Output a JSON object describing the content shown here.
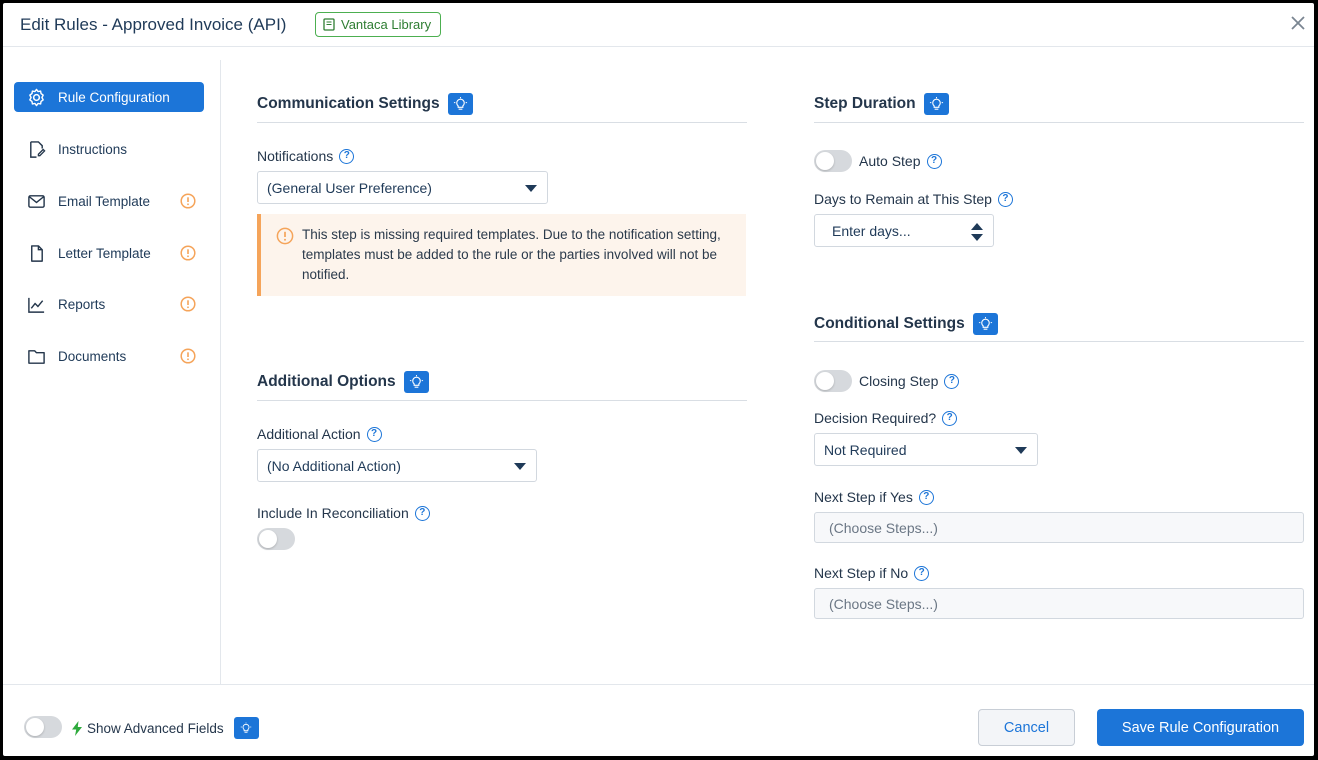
{
  "header": {
    "title": "Edit Rules - Approved Invoice (API)",
    "library_badge": "Vantaca Library",
    "close_icon": "close-icon"
  },
  "sidebar": {
    "items": [
      {
        "label": "Rule Configuration",
        "icon": "gear-icon",
        "active": true,
        "warning": false
      },
      {
        "label": "Instructions",
        "icon": "edit-document-icon",
        "active": false,
        "warning": false
      },
      {
        "label": "Email Template",
        "icon": "envelope-icon",
        "active": false,
        "warning": true
      },
      {
        "label": "Letter Template",
        "icon": "file-icon",
        "active": false,
        "warning": true
      },
      {
        "label": "Reports",
        "icon": "line-chart-icon",
        "active": false,
        "warning": true
      },
      {
        "label": "Documents",
        "icon": "folder-icon",
        "active": false,
        "warning": true
      }
    ]
  },
  "communication": {
    "heading": "Communication Settings",
    "notifications_label": "Notifications",
    "notifications_value": "(General User Preference)",
    "alert_text": "This step is missing required templates. Due to the notification setting, templates must be added to the rule or the parties involved will not be notified."
  },
  "additional": {
    "heading": "Additional Options",
    "action_label": "Additional Action",
    "action_value": "(No Additional Action)",
    "reconciliation_label": "Include In Reconciliation",
    "reconciliation_on": false
  },
  "duration": {
    "heading": "Step Duration",
    "auto_step_label": "Auto Step",
    "auto_step_on": false,
    "days_label": "Days to Remain at This Step",
    "days_placeholder": "Enter days..."
  },
  "conditional": {
    "heading": "Conditional Settings",
    "closing_step_label": "Closing Step",
    "closing_step_on": false,
    "decision_label": "Decision Required?",
    "decision_value": "Not Required",
    "next_yes_label": "Next Step if Yes",
    "next_yes_placeholder": "(Choose Steps...)",
    "next_no_label": "Next Step if No",
    "next_no_placeholder": "(Choose Steps...)"
  },
  "footer": {
    "advanced_label": "Show Advanced Fields",
    "advanced_on": false,
    "cancel_label": "Cancel",
    "save_label": "Save Rule Configuration"
  },
  "colors": {
    "accent": "#1c75d8",
    "warning": "#f5a45a",
    "library_green": "#4caf50"
  }
}
